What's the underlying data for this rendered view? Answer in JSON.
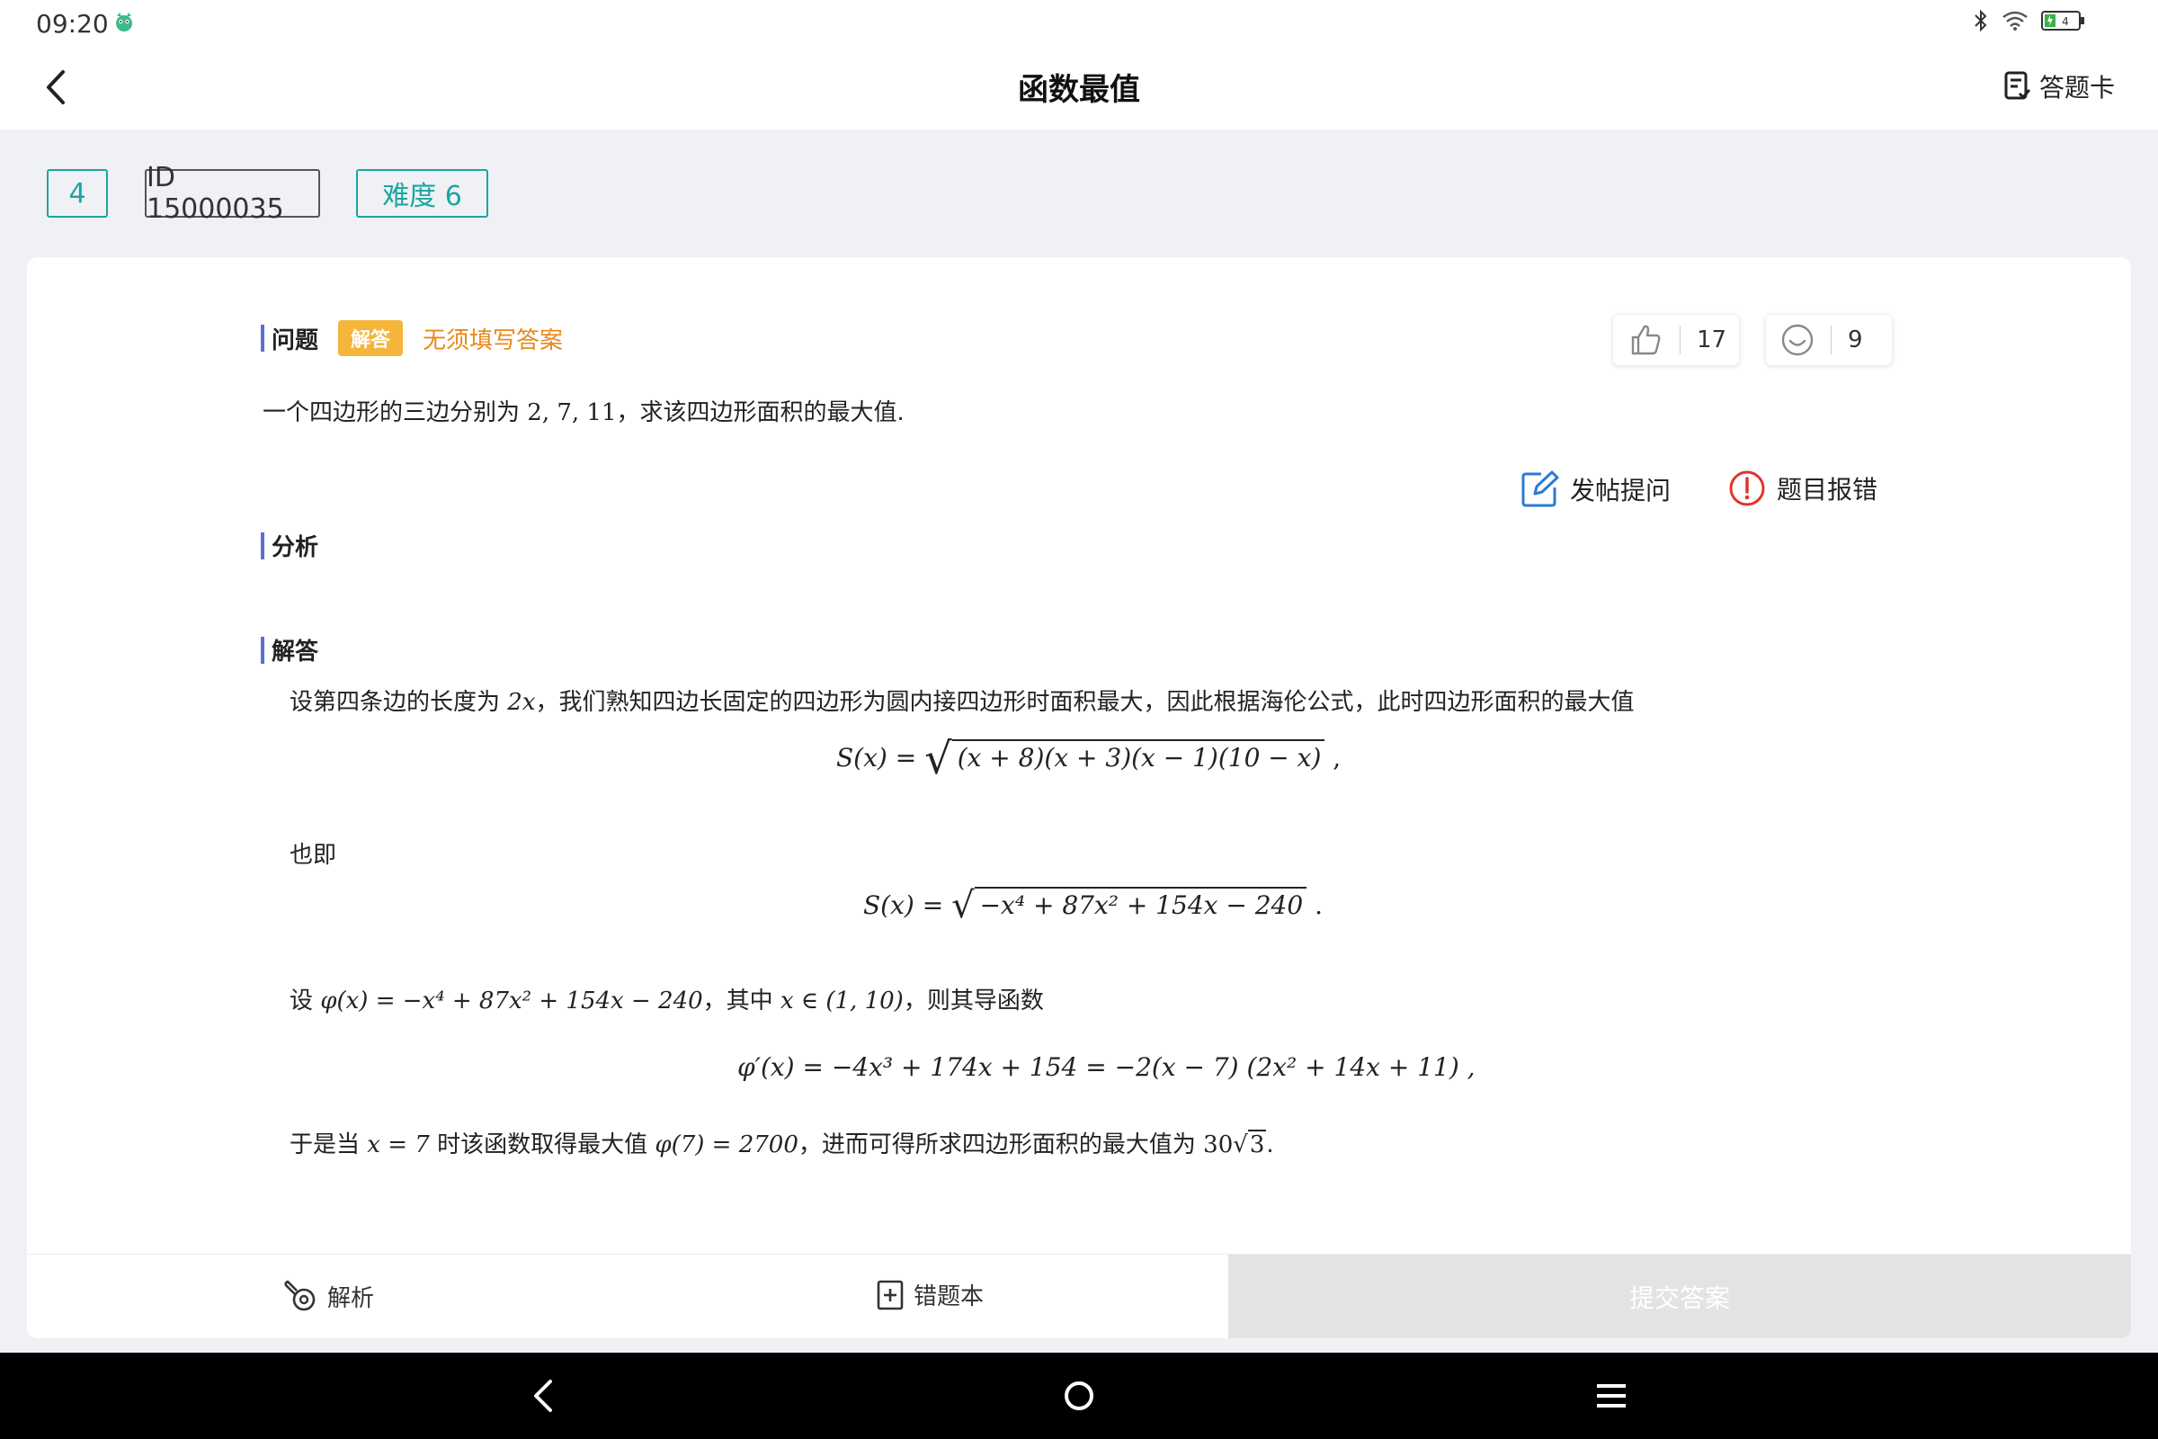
{
  "status": {
    "time": "09:20",
    "battery_level": "4"
  },
  "header": {
    "title": "函数最值",
    "answer_card_label": "答题卡"
  },
  "tags": {
    "index": "4",
    "id": "ID 15000035",
    "difficulty": "难度 6"
  },
  "problem": {
    "section_label": "问题",
    "type_badge": "解答",
    "no_fill_note": "无须填写答案",
    "likes": "17",
    "smiles": "9",
    "text_prefix": "一个四边形的三边分别为",
    "text_numbers": "2, 7, 11",
    "text_suffix": "，求该四边形面积的最大值."
  },
  "actions": {
    "post_question": "发帖提问",
    "report_error": "题目报错"
  },
  "analysis": {
    "section_label": "分析"
  },
  "solution": {
    "section_label": "解答",
    "line1_prefix": "设第四条边的长度为",
    "line1_var": "2x",
    "line1_suffix": "，我们熟知四边长固定的四边形为圆内接四边形时面积最大，因此根据海伦公式，此时四边形面积的最大值",
    "formula1_lhs": "S(x) = ",
    "formula1_radicand": "(x + 8)(x + 3)(x − 1)(10 − x)",
    "formula1_tail": " ,",
    "line2": "也即",
    "formula2_lhs": "S(x) = ",
    "formula2_radicand": "−x⁴ + 87x² + 154x − 240",
    "formula2_tail": " .",
    "line3_prefix": "设",
    "line3_def": "φ(x) = −x⁴ + 87x² + 154x − 240",
    "line3_mid": "，其中",
    "line3_domain": "x ∈ (1, 10)",
    "line3_suffix": "，则其导函数",
    "formula3": "φ′(x) = −4x³ + 174x + 154 = −2(x − 7) (2x² + 14x + 11) ,",
    "line4_prefix": "于是当",
    "line4_cond": "x = 7",
    "line4_mid": "时该函数取得最大值",
    "line4_value": "φ(7) = 2700",
    "line4_mid2": "，进而可得所求四边形面积的最大值为",
    "line4_result_coef": "30",
    "line4_result_root": "3",
    "line4_end": "."
  },
  "bottom": {
    "analysis_label": "解析",
    "mistake_book_label": "错题本",
    "submit_label": "提交答案"
  },
  "colors": {
    "teal": "#1aa6a0",
    "accent_bar": "#5a6fd8",
    "badge": "#f4b53a",
    "orange_text": "#e8891a",
    "report_red": "#e0352b",
    "edit_blue": "#2a7bd6"
  }
}
